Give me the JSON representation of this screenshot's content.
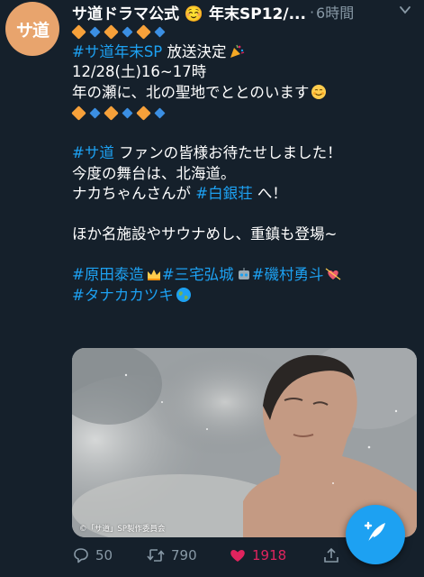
{
  "account": {
    "avatar_text": "サ道",
    "display_name": "サ道ドラマ公式 ☺️ 年末SP12/...",
    "separator": "·",
    "time": "6時間"
  },
  "tweet": {
    "line2_hashtag": "#サ道年末SP",
    "line2_text": " 放送決定",
    "line3": "12/28(土)16~17時",
    "line4": "年の瀬に、北の聖地でととのいます",
    "line6_hashtag": "#サ道",
    "line6_text": " ファンの皆様お待たせしました！",
    "line7": "今度の舞台は、北海道。",
    "line8_text": "ナカちゃんさんが ",
    "line8_hashtag": "#白銀荘",
    "line8_tail": " へ！",
    "line10": "ほか名施設やサウナめし、重鎮も登場~",
    "tag_harada": "#原田泰造",
    "tag_miyake": "#三宅弘城",
    "tag_isomura": "#磯村勇斗",
    "tag_tanaka": "#タナカカツキ"
  },
  "media": {
    "caption": "©「サ道」SP製作委員会"
  },
  "actions": {
    "reply_count": "50",
    "retweet_count": "790",
    "like_count": "1918"
  },
  "icons": {
    "reply": "reply-icon",
    "retweet": "retweet-icon",
    "like": "heart-icon",
    "share": "share-icon",
    "compose": "compose-tweet-icon",
    "more": "chevron-down-icon"
  },
  "colors": {
    "background": "#15202b",
    "link": "#1da1f2",
    "like": "#e0245e",
    "muted": "#8899a6"
  }
}
